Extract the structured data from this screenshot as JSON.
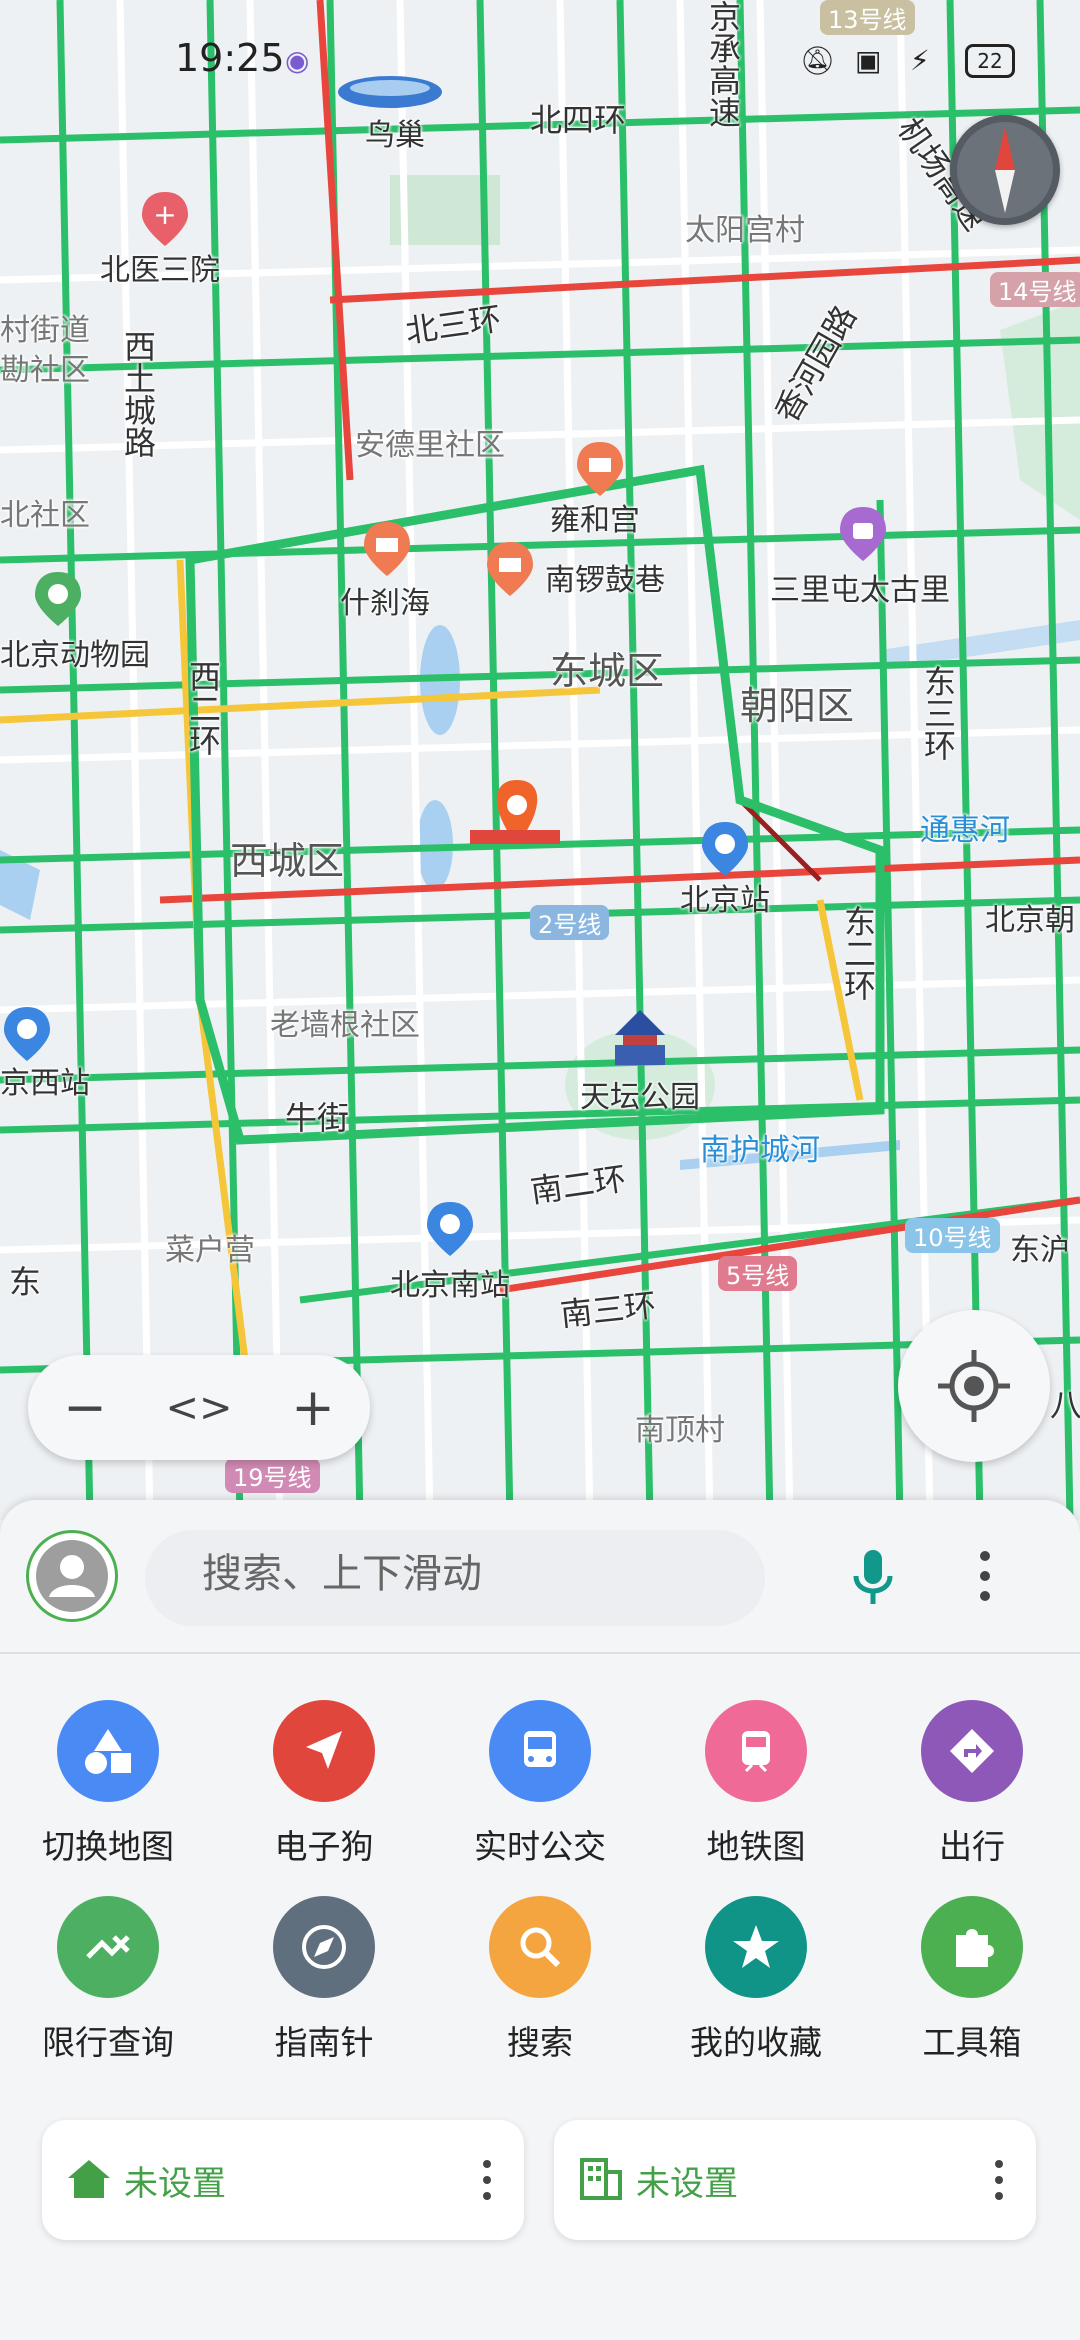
{
  "status_bar": {
    "time": "19:25",
    "battery": "22"
  },
  "map": {
    "labels": {
      "niaochao": "鸟巢",
      "beisihuan": "北四环",
      "taiyanggongcun": "太阳宫村",
      "beiyisanyuan": "北医三院",
      "cunjiedao": "村街道",
      "shequ1": "勘社区",
      "beisanhuan": "北三环",
      "xitucheng": "西土城路",
      "andeli": "安德里社区",
      "xiangheyuan": "香河园路",
      "beishequ": "北社区",
      "yonghegong": "雍和宫",
      "shichahai": "什刹海",
      "nanluoguxiang": "南锣鼓巷",
      "sanlitun": "三里屯太古里",
      "dongwuyuan": "北京动物园",
      "dongcheng": "东城区",
      "chaoyang": "朝阳区",
      "xierhuan": "西二环",
      "dongsanhuan": "东三环",
      "xicheng": "西城区",
      "beijingzhan": "北京站",
      "tonghuihe": "通惠河",
      "line2": "2号线",
      "beijingchao": "北京朝",
      "dongerhuan": "东二环",
      "laoqianggen": "老墙根社区",
      "beijingxizhan": "京西站",
      "tiantan": "天坛公园",
      "niujie": "牛街",
      "nanhuchenghe": "南护城河",
      "nanerhuan": "南二环",
      "caihuying": "菜户营",
      "line10": "10号线",
      "dongnan": "东沪",
      "beijingnan": "北京南站",
      "line5": "5号线",
      "nansanhuan": "南三环",
      "nandingcun": "南顶村",
      "line19": "19号线",
      "line14": "14号线",
      "line13": "13号线",
      "jichanggaosu": "机场高速",
      "jingchenggaosu": "京承高速",
      "dong": "东",
      "ba": "八"
    }
  },
  "controls": {
    "zoom_out": "−",
    "zoom_toggle": "<>",
    "zoom_in": "+"
  },
  "search": {
    "placeholder": "搜索、上下滑动"
  },
  "grid": [
    {
      "label": "切换地图",
      "icon": "shapes-icon",
      "color": "#4a8af4"
    },
    {
      "label": "电子狗",
      "icon": "navigation-arrow-icon",
      "color": "#e0463b"
    },
    {
      "label": "实时公交",
      "icon": "bus-icon",
      "color": "#4a8af4"
    },
    {
      "label": "地铁图",
      "icon": "subway-icon",
      "color": "#f06a98"
    },
    {
      "label": "出行",
      "icon": "directions-icon",
      "color": "#8e58b8"
    },
    {
      "label": "限行查询",
      "icon": "restriction-icon",
      "color": "#4caf62"
    },
    {
      "label": "指南针",
      "icon": "compass-icon",
      "color": "#5f6f7d"
    },
    {
      "label": "搜索",
      "icon": "search-icon",
      "color": "#f5a540"
    },
    {
      "label": "我的收藏",
      "icon": "star-icon",
      "color": "#109487"
    },
    {
      "label": "工具箱",
      "icon": "puzzle-icon",
      "color": "#4caf50"
    }
  ],
  "cards": {
    "home": "未设置",
    "work": "未设置"
  }
}
